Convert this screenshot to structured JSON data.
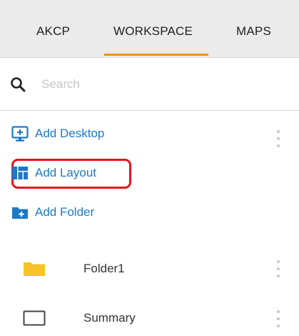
{
  "tabs": [
    {
      "label": "AKCP"
    },
    {
      "label": "WORKSPACE",
      "active": true
    },
    {
      "label": "MAPS"
    }
  ],
  "accent_color": "#f0901e",
  "link_color": "#1e78c8",
  "highlight_color": "#e8131b",
  "search": {
    "placeholder": "Search",
    "icon": "search-icon"
  },
  "actions": [
    {
      "label": "Add Desktop",
      "icon": "add-desktop-icon"
    },
    {
      "label": "Add Layout",
      "icon": "layout-icon",
      "highlighted": true
    },
    {
      "label": "Add Folder",
      "icon": "add-folder-icon"
    }
  ],
  "items": [
    {
      "label": "Folder1",
      "icon": "folder-icon",
      "icon_color": "#f7c326"
    },
    {
      "label": "Summary",
      "icon": "desktop-icon"
    }
  ]
}
